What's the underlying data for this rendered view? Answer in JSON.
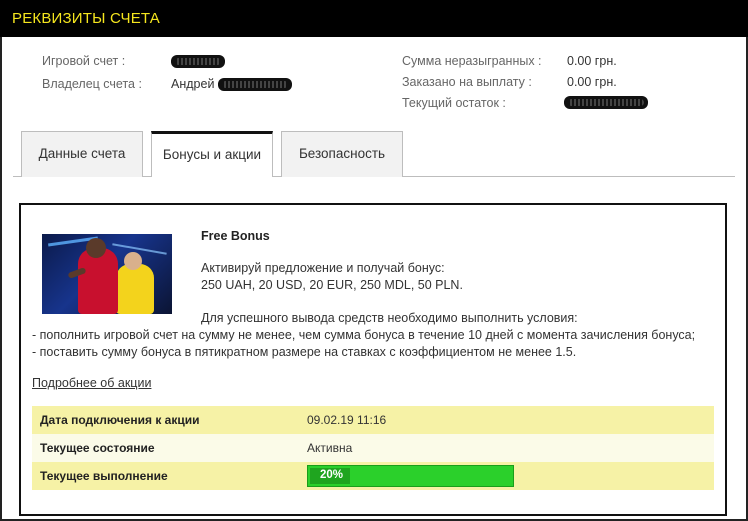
{
  "header": {
    "title": "РЕКВИЗИТЫ СЧЕТА"
  },
  "account": {
    "game_account_label": "Игровой счет :",
    "owner_label": "Владелец счета :",
    "owner_value": "Андрей",
    "unplayed_label": "Сумма неразыгранных :",
    "unplayed_value": "0.00 грн.",
    "withdraw_label": "Заказано на выплату :",
    "withdraw_value": "0.00 грн.",
    "balance_label": "Текущий остаток :"
  },
  "tabs": [
    {
      "label": "Данные счета",
      "active": false
    },
    {
      "label": "Бонусы и акции",
      "active": true
    },
    {
      "label": "Безопасность",
      "active": false
    }
  ],
  "bonus": {
    "title": "Free Bonus",
    "line1": "Активируй предложение и получай бонус:",
    "line2": "250 UAH, 20 USD, 20 EUR, 250 MDL, 50 PLN.",
    "line3": "Для успешного вывода средств необходимо выполнить условия:",
    "line4": "- пополнить игровой счет на сумму не менее, чем сумма бонуса в течение 10 дней с момента зачисления бонуса;",
    "line5": "- поставить сумму бонуса в пятикратном размере на ставках с коэффициентом не менее 1.5.",
    "more_link": "Подробнее об акции"
  },
  "details": {
    "date_label": "Дата подключения к акции",
    "date_value": "09.02.19 11:16",
    "status_label": "Текущее состояние",
    "status_value": "Активна",
    "progress_label": "Текущее выполнение",
    "progress_value": "20%",
    "progress_fraction": 0.2
  },
  "colors": {
    "accent": "#f5e61e",
    "row_yellow": "#f6f2a6",
    "progress_green": "#2bd02b"
  }
}
